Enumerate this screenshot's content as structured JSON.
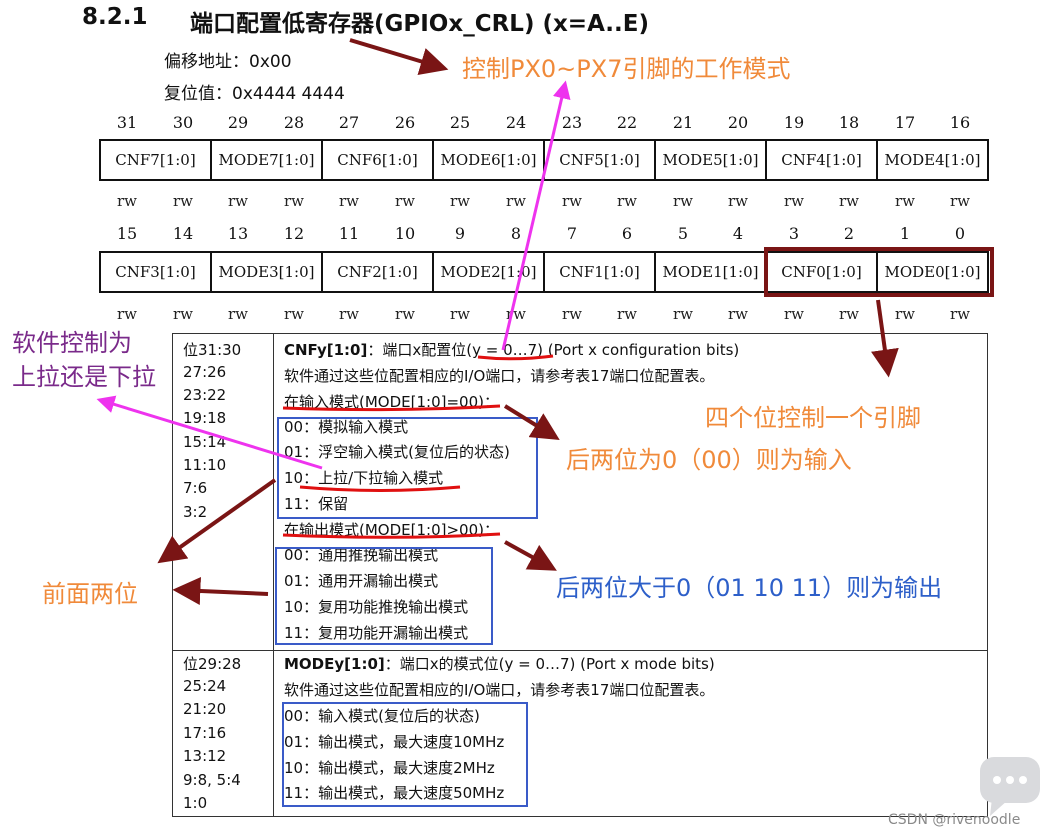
{
  "header": {
    "section_number": "8.2.1",
    "title": "端口配置低寄存器(GPIOx_CRL) (x=A..E)",
    "offset": "偏移地址：0x00",
    "reset": "复位值：0x4444 4444"
  },
  "bits_high": [
    "31",
    "30",
    "29",
    "28",
    "27",
    "26",
    "25",
    "24",
    "23",
    "22",
    "21",
    "20",
    "19",
    "18",
    "17",
    "16"
  ],
  "bits_low": [
    "15",
    "14",
    "13",
    "12",
    "11",
    "10",
    "9",
    "8",
    "7",
    "6",
    "5",
    "4",
    "3",
    "2",
    "1",
    "0"
  ],
  "rw": "rw",
  "register_high": [
    "CNF7[1:0]",
    "MODE7[1:0]",
    "CNF6[1:0]",
    "MODE6[1:0]",
    "CNF5[1:0]",
    "MODE5[1:0]",
    "CNF4[1:0]",
    "MODE4[1:0]"
  ],
  "register_low": [
    "CNF3[1:0]",
    "MODE3[1:0]",
    "CNF2[1:0]",
    "MODE2[1:0]",
    "CNF1[1:0]",
    "MODE1[1:0]",
    "CNF0[1:0]",
    "MODE0[1:0]"
  ],
  "cnf_section": {
    "bits": [
      "位31:30",
      "27:26",
      "23:22",
      "19:18",
      "15:14",
      "11:10",
      "7:6",
      "3:2"
    ],
    "heading_bold": "CNFy[1:0]",
    "heading_rest": "：端口x配置位(y = 0…7) (Port x configuration bits)",
    "desc": "软件通过这些位配置相应的I/O端口，请参考表17端口位配置表。",
    "input_title": "在输入模式(MODE[1:0]=00)：",
    "input_items": [
      "00：模拟输入模式",
      "01：浮空输入模式(复位后的状态)",
      "10：上拉/下拉输入模式",
      "11：保留"
    ],
    "output_title": "在输出模式(MODE[1:0]>00)：",
    "output_items": [
      "00：通用推挽输出模式",
      "01：通用开漏输出模式",
      "10：复用功能推挽输出模式",
      "11：复用功能开漏输出模式"
    ]
  },
  "mode_section": {
    "bits": [
      "位29:28",
      "25:24",
      "21:20",
      "17:16",
      "13:12",
      "9:8, 5:4",
      "1:0"
    ],
    "heading_bold": "MODEy[1:0]",
    "heading_rest": "：端口x的模式位(y = 0…7) (Port x mode bits)",
    "desc": "软件通过这些位配置相应的I/O端口，请参考表17端口位配置表。",
    "items": [
      "00：输入模式(复位后的状态)",
      "01：输出模式，最大速度10MHz",
      "10：输出模式，最大速度2MHz",
      "11：输出模式，最大速度50MHz"
    ]
  },
  "annotations": {
    "px_control": "控制PX0~PX7引脚的工作模式",
    "pull_line1": "软件控制为",
    "pull_line2": "上拉还是下拉",
    "four_bits": "四个位控制一个引脚",
    "input_rule": "后两位为0（00）则为输入",
    "front_two": "前面两位",
    "output_rule": "后两位大于0（01 10 11）则为输出"
  },
  "watermark": "CSDN @rivenoodle",
  "colors": {
    "orange": "#f08a3a",
    "purple": "#7a2a8a",
    "blue": "#2d5fc9",
    "dark_red": "#7a1515",
    "red": "#e01010",
    "magenta": "#ee33ee"
  }
}
